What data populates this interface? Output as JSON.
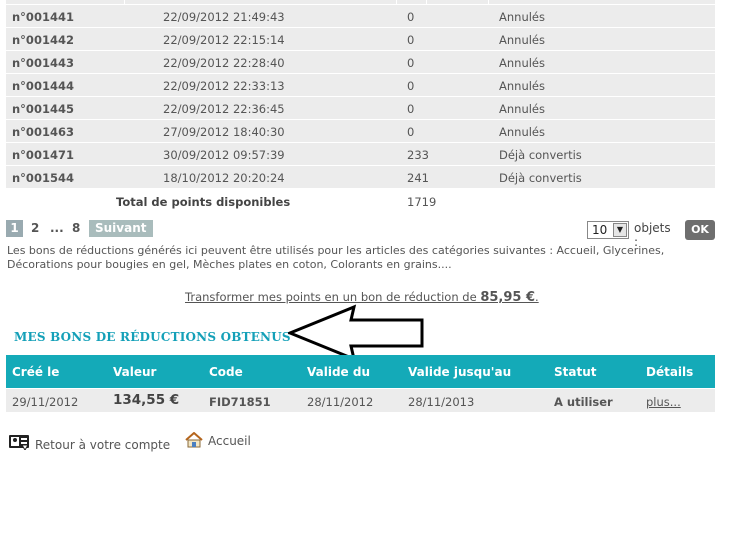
{
  "points_table": {
    "rows": [
      {
        "id": "n°001441",
        "date": "22/09/2012 21:49:43",
        "points": "0",
        "status": "Annulés"
      },
      {
        "id": "n°001442",
        "date": "22/09/2012 22:15:14",
        "points": "0",
        "status": "Annulés"
      },
      {
        "id": "n°001443",
        "date": "22/09/2012 22:28:40",
        "points": "0",
        "status": "Annulés"
      },
      {
        "id": "n°001444",
        "date": "22/09/2012 22:33:13",
        "points": "0",
        "status": "Annulés"
      },
      {
        "id": "n°001445",
        "date": "22/09/2012 22:36:45",
        "points": "0",
        "status": "Annulés"
      },
      {
        "id": "n°001463",
        "date": "27/09/2012 18:40:30",
        "points": "0",
        "status": "Annulés"
      },
      {
        "id": "n°001471",
        "date": "30/09/2012 09:57:39",
        "points": "233",
        "status": "Déjà convertis"
      },
      {
        "id": "n°001544",
        "date": "18/10/2012 20:20:24",
        "points": "241",
        "status": "Déjà convertis"
      }
    ],
    "total_label": "Total de points disponibles",
    "total_value": "1719"
  },
  "pagination": {
    "current": "1",
    "page2": "2",
    "ellipsis": "...",
    "last": "8",
    "next": "Suivant »",
    "per_page": "10",
    "objects_label": "objets :",
    "ok": "OK"
  },
  "info_text": "Les bons de réductions générés ici peuvent être utilisés pour les articles des catégories suivantes : Accueil, Glycerines, Décorations pour bougies en gel, Mèches plates en coton, Colorants en grains....",
  "transform": {
    "text": "Transformer mes points en un bon de réduction de ",
    "amount": "85,95 €",
    "end": "."
  },
  "section_title": "MES BONS DE RÉDUCTIONS OBTENUS",
  "vouchers": {
    "headers": [
      "Créé le",
      "Valeur",
      "Code",
      "Valide du",
      "Valide jusqu'au",
      "Statut",
      "Détails"
    ],
    "rows": [
      {
        "created": "29/11/2012",
        "value": "134,55 €",
        "code": "FID71851",
        "from": "28/11/2012",
        "to": "28/11/2013",
        "status": "A utiliser",
        "details": "plus..."
      }
    ]
  },
  "footer": {
    "back": "Retour à votre compte",
    "home": "Accueil"
  },
  "colors": {
    "accent": "#14aab8",
    "row_bg": "#ececec",
    "ok_bg": "#6e6e6e"
  }
}
